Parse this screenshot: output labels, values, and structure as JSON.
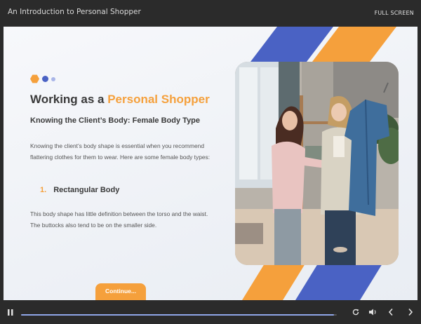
{
  "window": {
    "title": "An Introduction to Personal Shopper",
    "fullscreen_label": "FULL SCREEN"
  },
  "slide": {
    "heading_main": "Working as a ",
    "heading_accent": "Personal Shopper",
    "subheading": "Knowing the Client’s Body: Female Body Type",
    "intro_paragraph": "Knowing the client’s body shape is essential when you recommend flattering clothes for them to wear. Here are some female body types:",
    "list_number": "1.",
    "list_item": "Rectangular Body",
    "detail_paragraph": "This body shape has little definition between the torso and the waist. The buttocks also tend to be on the smaller side.",
    "continue_label": "Continue..."
  },
  "player": {
    "progress_fraction": 0.99,
    "icons": [
      "pause-icon",
      "replay-icon",
      "volume-icon",
      "previous-icon",
      "next-icon"
    ]
  },
  "colors": {
    "accent_orange": "#f5a03c",
    "accent_blue": "#4a62c4",
    "chrome": "#2b2b2b"
  }
}
